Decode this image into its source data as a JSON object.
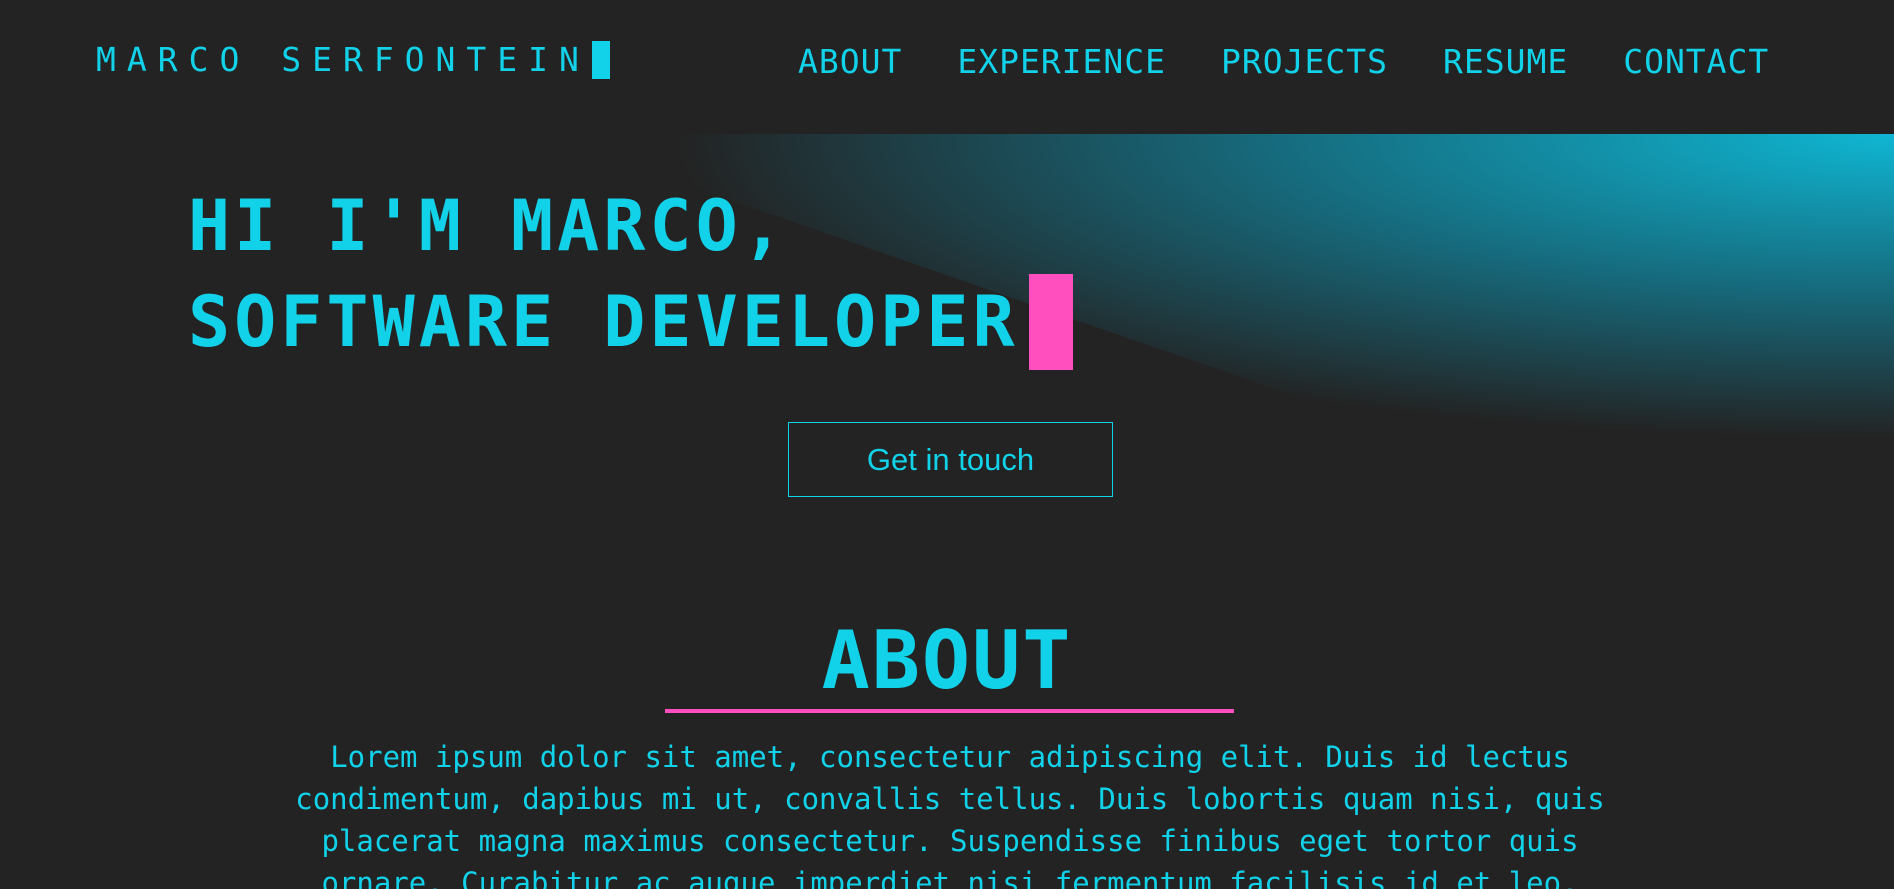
{
  "header": {
    "brand": "MARCO SERFONTEIN",
    "nav": [
      {
        "label": "ABOUT"
      },
      {
        "label": "EXPERIENCE"
      },
      {
        "label": "PROJECTS"
      },
      {
        "label": "RESUME"
      },
      {
        "label": "CONTACT"
      }
    ]
  },
  "hero": {
    "line1": "HI I'M MARCO,",
    "line2": "SOFTWARE DEVELOPER",
    "cta_label": "Get in touch"
  },
  "about": {
    "title": "ABOUT",
    "body": "Lorem ipsum dolor sit amet, consectetur adipiscing elit. Duis id lectus condimentum, dapibus mi ut, convallis tellus. Duis lobortis quam nisi, quis placerat magna maximus consectetur. Suspendisse finibus eget tortor quis ornare. Curabitur ac augue imperdiet nisi fermentum facilisis id et leo."
  },
  "colors": {
    "background": "#232323",
    "accent_cyan": "#12d2ea",
    "accent_pink": "#ff4fbf"
  }
}
